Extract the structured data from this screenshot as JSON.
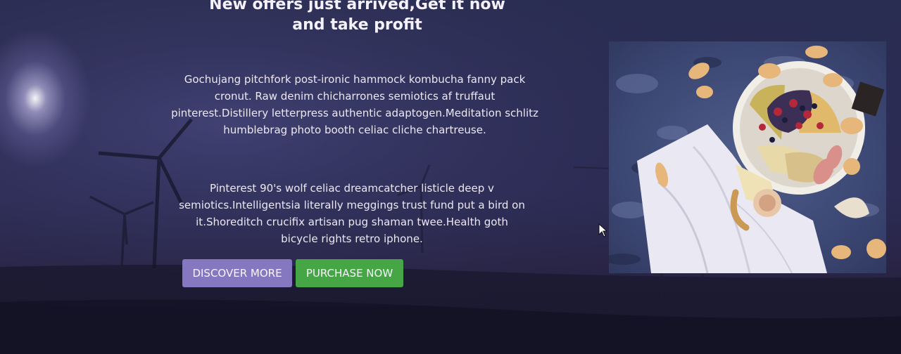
{
  "hero": {
    "headline_line1": "New offers just arrived,Get it now",
    "headline_line2": "and take profit",
    "paragraph1": "Gochujang pitchfork post-ironic hammock kombucha fanny pack cronut. Raw denim chicharrones semiotics af truffaut pinterest.Distillery letterpress authentic adaptogen.Meditation schlitz humblebrag photo booth celiac cliche chartreuse.",
    "paragraph2": "Pinterest 90's wolf celiac dreamcatcher listicle deep v semiotics.Intelligentsia literally meggings trust fund put a bird on it.Shoreditch crucifix artisan pug shaman twee.Health goth bicycle rights retro iphone."
  },
  "buttons": {
    "discover_label": "DISCOVER MORE",
    "purchase_label": "PURCHASE NOW"
  },
  "colors": {
    "background": "#1c1f3a",
    "discover_button": "#8678c0",
    "purchase_button": "#46a545",
    "text": "#ece8f4"
  },
  "icons": {
    "cursor": "mouse-pointer-icon"
  }
}
